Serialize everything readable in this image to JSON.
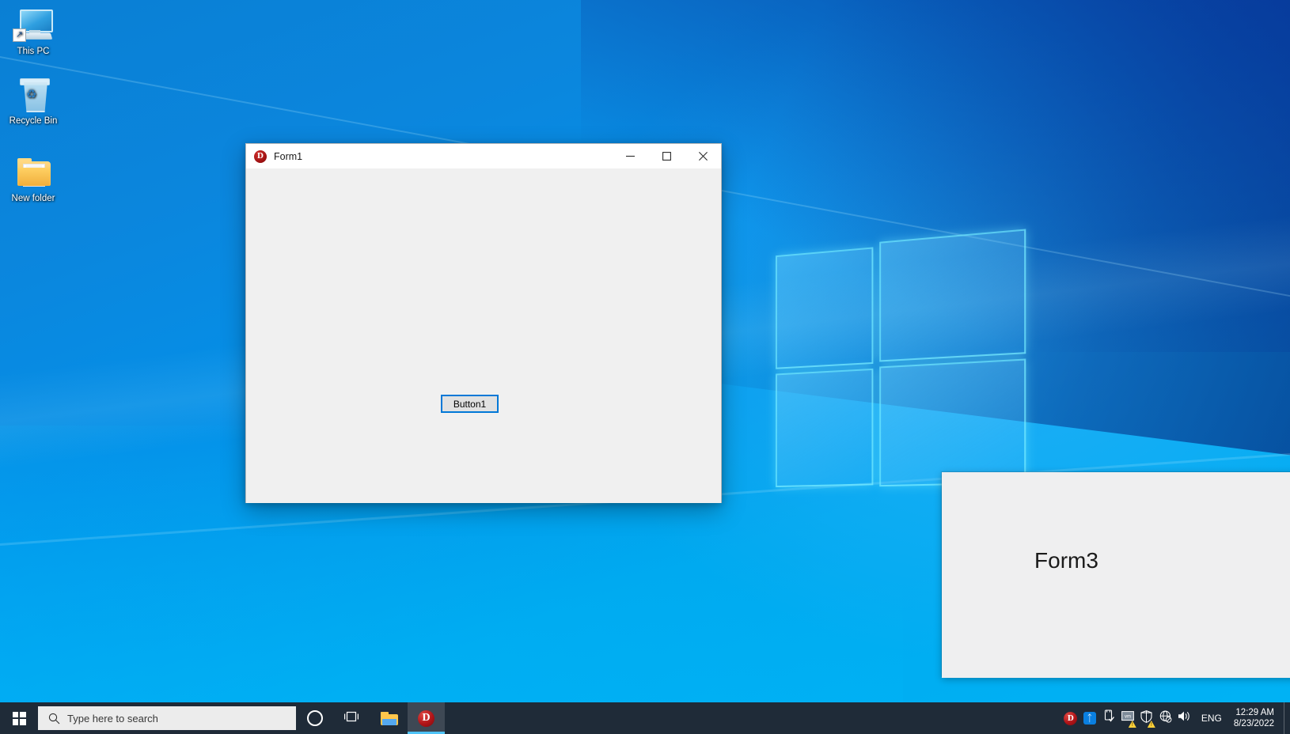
{
  "desktop": {
    "icons": [
      {
        "label": "This PC",
        "icon": "this-pc-icon"
      },
      {
        "label": "Recycle Bin",
        "icon": "recycle-bin-icon"
      },
      {
        "label": "New folder",
        "icon": "folder-icon"
      }
    ]
  },
  "form1": {
    "title": "Form1",
    "app_icon": "D",
    "minimize_label": "Minimize",
    "maximize_label": "Maximize",
    "close_label": "Close",
    "button1_label": "Button1"
  },
  "form3": {
    "title_label": "Form3"
  },
  "taskbar": {
    "start_label": "Start",
    "search": {
      "placeholder": "Type here to search",
      "icon": "search-icon"
    },
    "buttons": [
      {
        "name": "cortana",
        "label": "Cortana",
        "icon": "circle-icon"
      },
      {
        "name": "task-view",
        "label": "Task View",
        "icon": "task-view-icon"
      },
      {
        "name": "file-explorer",
        "label": "File Explorer",
        "icon": "folder-icon"
      },
      {
        "name": "delphi-app",
        "label": "Delphi Application",
        "icon": "delphi-d-icon",
        "active": true
      }
    ],
    "tray": [
      {
        "name": "delphi-tray",
        "label": "Delphi",
        "icon": "delphi-d-icon"
      },
      {
        "name": "bluetooth",
        "label": "Bluetooth Devices",
        "icon": "bluetooth-icon"
      },
      {
        "name": "safely-remove",
        "label": "Safely Remove Hardware and Eject Media",
        "icon": "usb-eject-icon"
      },
      {
        "name": "vmware-tools",
        "label": "VMware Tools",
        "icon": "vm-warning-icon"
      },
      {
        "name": "security",
        "label": "Windows Security",
        "icon": "shield-warning-icon"
      },
      {
        "name": "network",
        "label": "No Internet access",
        "icon": "globe-offline-icon"
      },
      {
        "name": "volume",
        "label": "Speakers",
        "icon": "volume-icon"
      }
    ],
    "language": "ENG",
    "clock": {
      "time": "12:29 AM",
      "date": "8/23/2022"
    }
  },
  "colors": {
    "accent": "#0078d7",
    "taskbar": "#1f2b38",
    "form_face": "#f0f0f0",
    "delphi_red": "#b01418",
    "wallpaper_blue": "#00a9ef"
  }
}
